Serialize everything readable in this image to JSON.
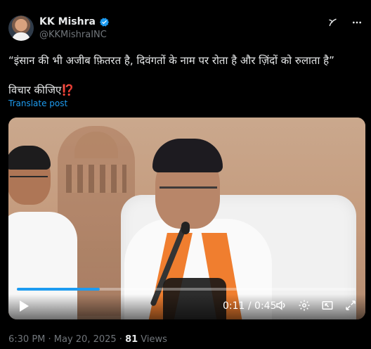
{
  "header": {
    "name": "KK Mishra",
    "handle": "@KKMishraINC"
  },
  "tweet": {
    "line1": "“इंसान की भी अजीब फ़ितरत है, दिवंगतों के नाम पर रोता है और ज़िंदों को रुलाता है”",
    "line2_text": "विचार कीजिए",
    "line2_emoji": "⁉️",
    "translate": "Translate post"
  },
  "video": {
    "time": "0:11 / 0:45",
    "progress": 0.244
  },
  "footer": {
    "datetime": "6:30 PM · May 20, 2025 · ",
    "views_count": "81",
    "views_label": " Views"
  },
  "colors": {
    "accent": "#1d9bf0",
    "background": "#000000",
    "text": "#e7e9ea",
    "muted": "#71767b",
    "scarf": "#f07e2f"
  },
  "icons": {
    "verified": "verified-badge-icon",
    "grok": "grok-icon",
    "more": "more-horizontal-icon",
    "play": "play-icon",
    "volume": "volume-icon",
    "settings": "settings-icon",
    "pip": "picture-in-picture-icon",
    "fullscreen": "fullscreen-icon"
  }
}
